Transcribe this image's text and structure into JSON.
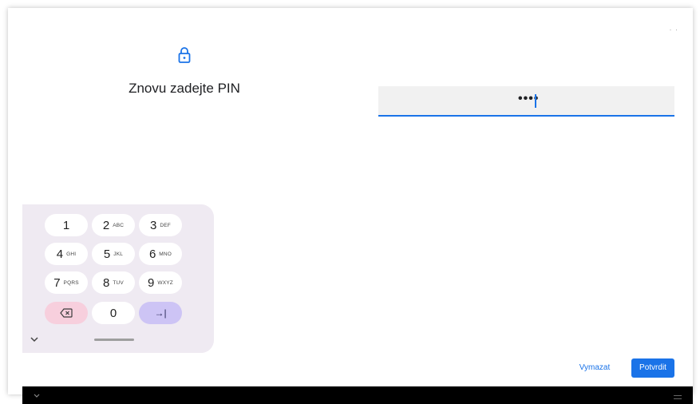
{
  "header": {
    "title": "Znovu zadejte PIN",
    "lock_icon": "lock-icon"
  },
  "pin": {
    "masked_value": "••••",
    "length": 4
  },
  "keypad": {
    "keys": [
      {
        "num": "1",
        "letters": ""
      },
      {
        "num": "2",
        "letters": "ABC"
      },
      {
        "num": "3",
        "letters": "DEF"
      },
      {
        "num": "4",
        "letters": "GHI"
      },
      {
        "num": "5",
        "letters": "JKL"
      },
      {
        "num": "6",
        "letters": "MNO"
      },
      {
        "num": "7",
        "letters": "PQRS"
      },
      {
        "num": "8",
        "letters": "TUV"
      },
      {
        "num": "9",
        "letters": "WXYZ"
      },
      {
        "num": "0",
        "letters": ""
      }
    ],
    "backspace_icon": "backspace-icon",
    "tab_icon": "tab-arrow-icon",
    "tab_symbol": "→|"
  },
  "actions": {
    "clear_label": "Vymazat",
    "confirm_label": "Potvrdit"
  },
  "colors": {
    "accent": "#1a73e8",
    "keypad_bg": "#efeaf2",
    "delete_key": "#f7cfdd",
    "tab_key": "#cdc4f5"
  }
}
